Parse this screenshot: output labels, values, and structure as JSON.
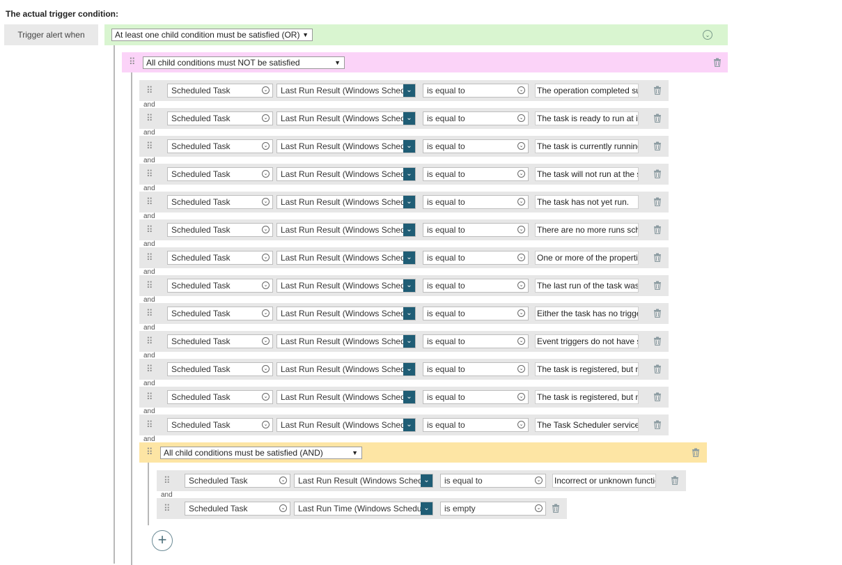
{
  "heading": "The actual trigger condition:",
  "trigger_label": "Trigger alert when",
  "root_operator": "At least one child condition must be satisfied (OR)",
  "not_group_operator": "All child conditions must NOT be satisfied",
  "and_group_operator": "All child conditions must be satisfied (AND)",
  "conjunction": "and",
  "not_rows": [
    {
      "object": "Scheduled Task",
      "property": "Last Run Result (Windows Scheduler)",
      "operator": "is equal to",
      "value": "The operation completed successfully."
    },
    {
      "object": "Scheduled Task",
      "property": "Last Run Result (Windows Scheduler)",
      "operator": "is equal to",
      "value": "The task is ready to run at its next scheduled time."
    },
    {
      "object": "Scheduled Task",
      "property": "Last Run Result (Windows Scheduler)",
      "operator": "is equal to",
      "value": "The task is currently running."
    },
    {
      "object": "Scheduled Task",
      "property": "Last Run Result (Windows Scheduler)",
      "operator": "is equal to",
      "value": "The task will not run at the scheduled times because it has been disabled."
    },
    {
      "object": "Scheduled Task",
      "property": "Last Run Result (Windows Scheduler)",
      "operator": "is equal to",
      "value": "The task has not yet run."
    },
    {
      "object": "Scheduled Task",
      "property": "Last Run Result (Windows Scheduler)",
      "operator": "is equal to",
      "value": "There are no more runs scheduled for this task."
    },
    {
      "object": "Scheduled Task",
      "property": "Last Run Result (Windows Scheduler)",
      "operator": "is equal to",
      "value": "One or more of the properties that are needed to run this task have not been set."
    },
    {
      "object": "Scheduled Task",
      "property": "Last Run Result (Windows Scheduler)",
      "operator": "is equal to",
      "value": "The last run of the task was terminated by the user."
    },
    {
      "object": "Scheduled Task",
      "property": "Last Run Result (Windows Scheduler)",
      "operator": "is equal to",
      "value": "Either the task has no triggers or the existing triggers are disabled or not set."
    },
    {
      "object": "Scheduled Task",
      "property": "Last Run Result (Windows Scheduler)",
      "operator": "is equal to",
      "value": "Event triggers do not have set run times."
    },
    {
      "object": "Scheduled Task",
      "property": "Last Run Result (Windows Scheduler)",
      "operator": "is equal to",
      "value": "The task is registered, but not all specified triggers will start the task."
    },
    {
      "object": "Scheduled Task",
      "property": "Last Run Result (Windows Scheduler)",
      "operator": "is equal to",
      "value": "The task is registered, but may fail to start."
    },
    {
      "object": "Scheduled Task",
      "property": "Last Run Result (Windows Scheduler)",
      "operator": "is equal to",
      "value": "The Task Scheduler service is not running."
    }
  ],
  "and_rows": [
    {
      "object": "Scheduled Task",
      "property": "Last Run Result (Windows Scheduler)",
      "operator": "is equal to",
      "value": "Incorrect or unknown function called."
    },
    {
      "object": "Scheduled Task",
      "property": "Last Run Time (Windows Scheduler)",
      "operator": "is empty",
      "value": ""
    }
  ],
  "add_button": "+"
}
